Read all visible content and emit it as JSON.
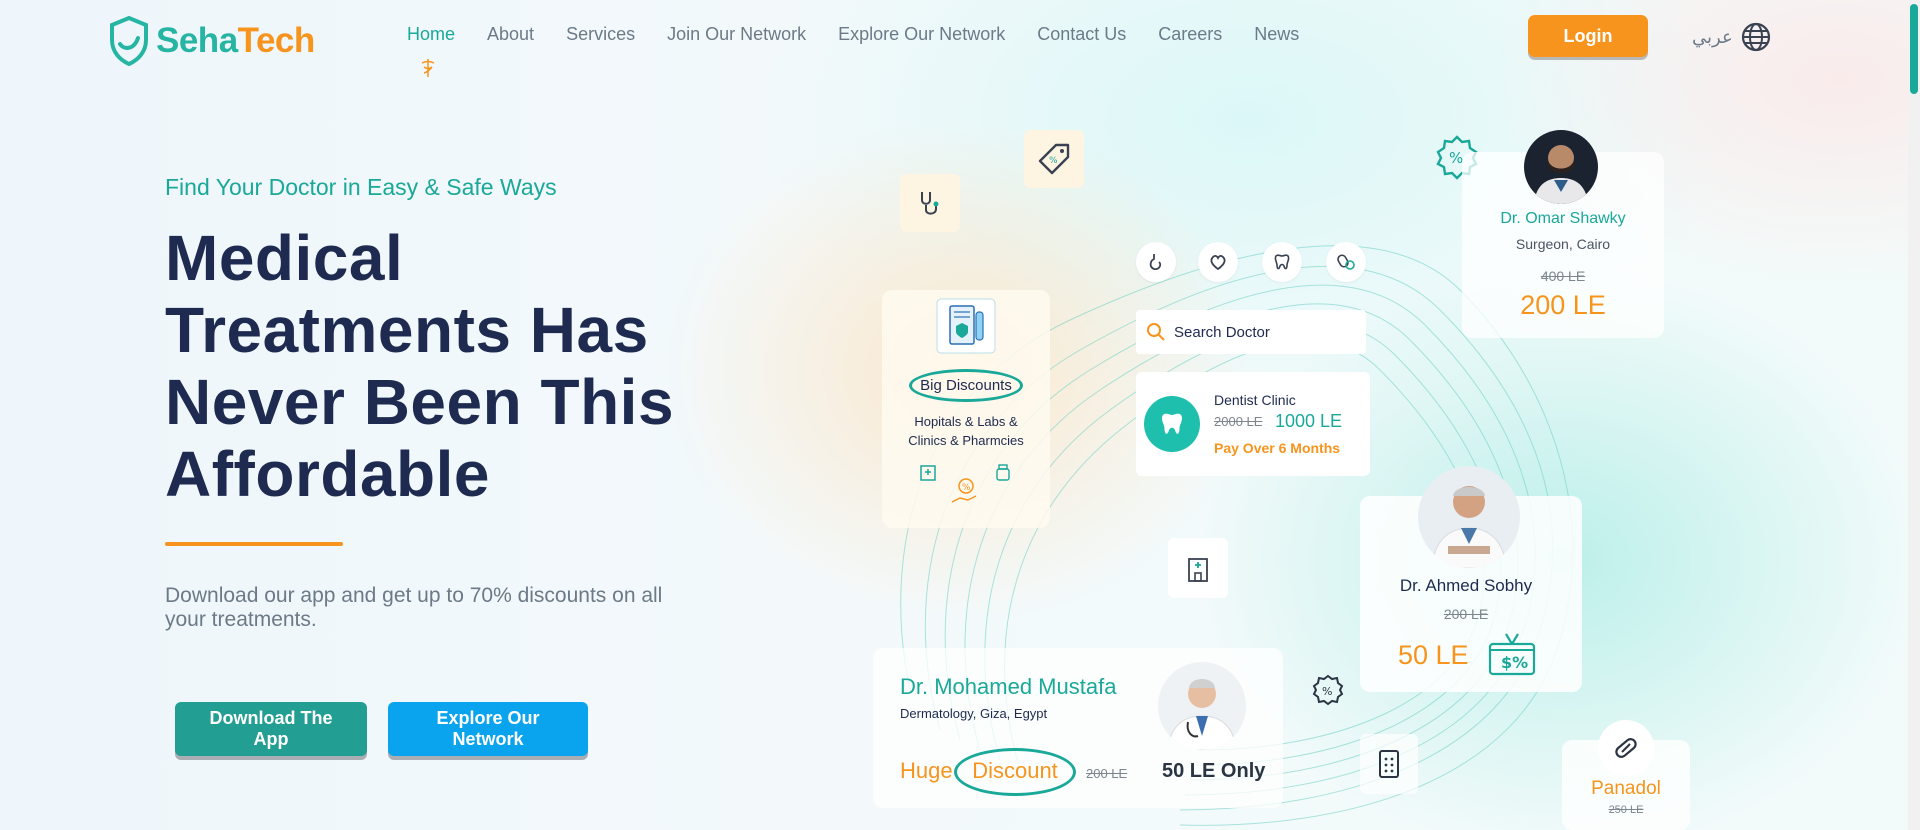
{
  "brand": {
    "name_part1": "Seha",
    "name_part2": "Tech",
    "teal": "#27b5a3",
    "orange": "#f7941d"
  },
  "nav": {
    "items": [
      {
        "label": "Home"
      },
      {
        "label": "About"
      },
      {
        "label": "Services"
      },
      {
        "label": "Join Our Network"
      },
      {
        "label": "Explore Our Network"
      },
      {
        "label": "Contact Us"
      },
      {
        "label": "Careers"
      },
      {
        "label": "News"
      }
    ],
    "login_label": "Login",
    "language_label": "عربي"
  },
  "hero": {
    "tagline": "Find Your Doctor in Easy & Safe Ways",
    "headline_lines": [
      "Medical",
      "Treatments Has",
      "Never Been This",
      "Affordable"
    ],
    "subtext": "Download our app and get up to 70% discounts on all your treatments.",
    "download_label": "Download The App",
    "explore_label": "Explore Our Network"
  },
  "illustration": {
    "big_discounts": {
      "badge": "Big Discounts",
      "line1": "Hopitals & Labs &",
      "line2": "Clinics & Pharmcies"
    },
    "search_placeholder": "Search Doctor",
    "dentist": {
      "title": "Dentist Clinic",
      "old_price": "2000 LE",
      "new_price": "1000 LE",
      "note": "Pay Over 6 Months"
    },
    "omar": {
      "name": "Dr. Omar Shawky",
      "role": "Surgeon, Cairo",
      "old_price": "400 LE",
      "new_price": "200 LE"
    },
    "ahmed": {
      "name": "Dr. Ahmed Sobhy",
      "old_price": "200 LE",
      "new_price": "50 LE"
    },
    "mustafa": {
      "name": "Dr. Mohamed Mustafa",
      "role": "Dermatology, Giza, Egypt",
      "huge": "Huge",
      "discount": "Discount",
      "old_price": "200 LE",
      "new_price": "50 LE Only"
    },
    "panadol": {
      "name": "Panadol",
      "old_price": "250 LE"
    }
  }
}
